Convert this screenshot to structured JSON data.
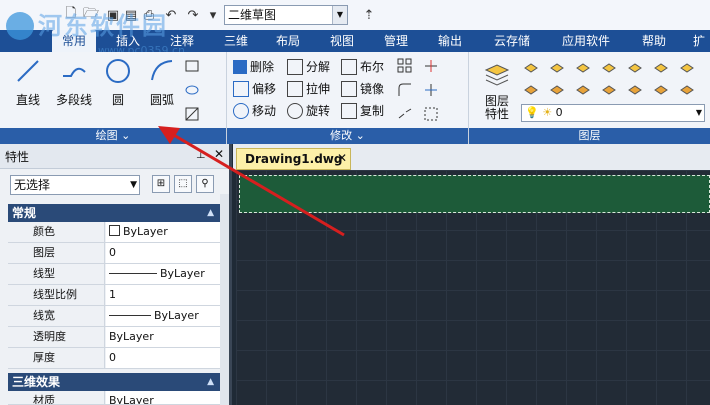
{
  "workspace": {
    "value": "二维草图"
  },
  "watermark": {
    "text": "河东软件园",
    "url": "www.pc0359.cn"
  },
  "tabs": [
    {
      "label": "常用"
    },
    {
      "label": "插入"
    },
    {
      "label": "注释"
    },
    {
      "label": "三维"
    },
    {
      "label": "布局"
    },
    {
      "label": "视图"
    },
    {
      "label": "管理"
    },
    {
      "label": "输出"
    },
    {
      "label": "云存储"
    },
    {
      "label": "应用软件"
    },
    {
      "label": "帮助"
    },
    {
      "label": "扩"
    }
  ],
  "draw_panel": {
    "title": "绘图",
    "tools": [
      {
        "label": "直线"
      },
      {
        "label": "多段线"
      },
      {
        "label": "圆"
      },
      {
        "label": "圆弧"
      }
    ]
  },
  "modify_panel": {
    "title": "修改",
    "tools": [
      {
        "label": "删除"
      },
      {
        "label": "分解"
      },
      {
        "label": "布尔"
      },
      {
        "label": "偏移"
      },
      {
        "label": "拉伸"
      },
      {
        "label": "镜像"
      },
      {
        "label": "移动"
      },
      {
        "label": "旋转"
      },
      {
        "label": "复制"
      }
    ]
  },
  "layer_panel": {
    "title": "图层",
    "properties_label": "图层\n特性",
    "current_layer": "0"
  },
  "document": {
    "tab_title": "Drawing1.dwg"
  },
  "properties": {
    "title": "特性",
    "selection": "无选择",
    "sections": [
      {
        "title": "常规",
        "rows": [
          {
            "key": "颜色",
            "value": "ByLayer"
          },
          {
            "key": "图层",
            "value": "0"
          },
          {
            "key": "线型",
            "value": "ByLayer"
          },
          {
            "key": "线型比例",
            "value": "1"
          },
          {
            "key": "线宽",
            "value": "ByLayer"
          },
          {
            "key": "透明度",
            "value": "ByLayer"
          },
          {
            "key": "厚度",
            "value": "0"
          }
        ]
      },
      {
        "title": "三维效果",
        "rows": [
          {
            "key": "材质",
            "value": "ByLayer"
          }
        ]
      }
    ]
  },
  "colors": {
    "tab_bar": "#1d4f96",
    "panel_title": "#2a5ea8",
    "canvas": "#222b36",
    "selection_fill": "#1d5b39",
    "arrow": "#d61f1f"
  }
}
